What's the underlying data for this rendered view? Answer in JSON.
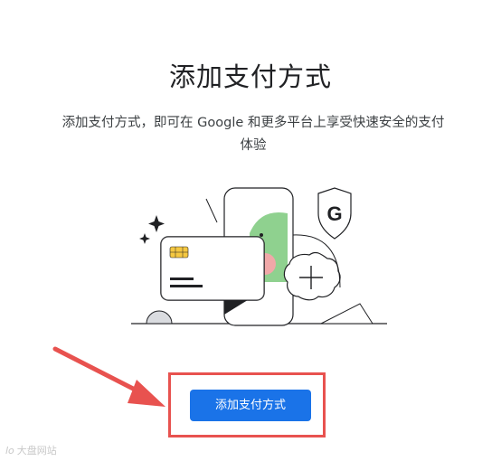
{
  "page": {
    "title": "添加支付方式",
    "description": "添加支付方式，即可在 Google 和更多平台上享受快速安全的支付体验",
    "cta_label": "添加支付方式"
  },
  "illustration": {
    "shield_letter": "G"
  },
  "watermark": {
    "logo_text": "lo",
    "text": "大盘网站"
  },
  "colors": {
    "accent": "#1a73e8",
    "highlight": "#e8524f",
    "card_chip": "#f5c842",
    "green": "#8fd18f",
    "pink": "#f0a8a8"
  }
}
